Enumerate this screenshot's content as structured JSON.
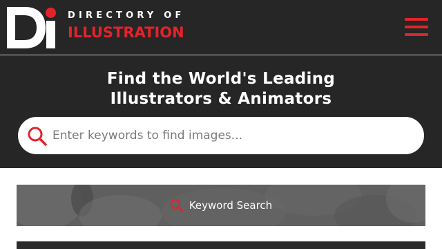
{
  "brand": {
    "monogram": "Di",
    "name_top": "DIRECTORY OF",
    "name_bottom": "ILLUSTRATION",
    "accent_color": "#e3232a",
    "dark_color": "#262626"
  },
  "header": {
    "menu_icon": "hamburger-menu-icon"
  },
  "hero": {
    "title_line1": "Find the World's Leading",
    "title_line2": "Illustrators & Animators",
    "search": {
      "placeholder": "Enter keywords to find images...",
      "value": "",
      "icon": "search-icon"
    }
  },
  "keyword_search": {
    "label": "Keyword Search",
    "icon": "search-icon"
  }
}
